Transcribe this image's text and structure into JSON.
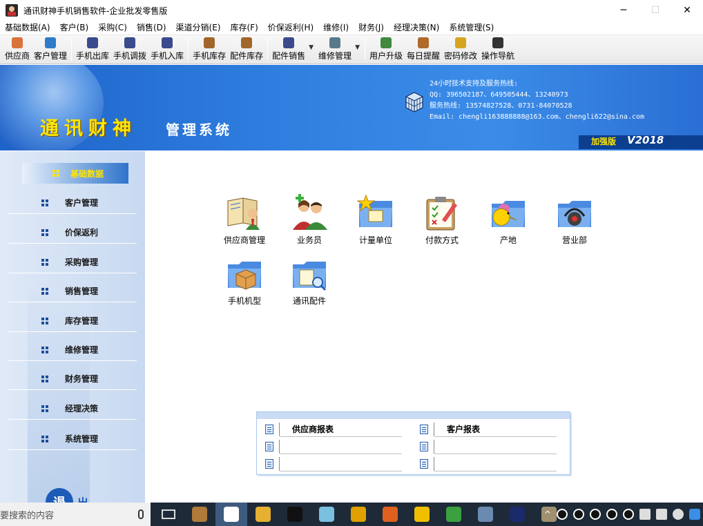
{
  "window": {
    "title": "通讯财神手机销售软件-企业批发零售版",
    "minimize": "─",
    "maximize": "☐",
    "close": "✕"
  },
  "menu": [
    "基础数据(A)",
    "客户(B)",
    "采购(C)",
    "销售(D)",
    "渠道分销(E)",
    "库存(F)",
    "价保返利(H)",
    "维修(I)",
    "财务(J)",
    "经理决策(N)",
    "系统管理(S)"
  ],
  "toolbar": {
    "groups": [
      [
        {
          "label": "供应商",
          "icon": "supplier-icon",
          "color": "#d9733b"
        },
        {
          "label": "客户管理",
          "icon": "customer-icon",
          "color": "#2e7bc9"
        }
      ],
      [
        {
          "label": "手机出库",
          "icon": "phone-out-icon",
          "color": "#3a4a8c"
        },
        {
          "label": "手机调拨",
          "icon": "phone-transfer-icon",
          "color": "#3a4a8c"
        },
        {
          "label": "手机入库",
          "icon": "phone-in-icon",
          "color": "#3a4a8c"
        }
      ],
      [
        {
          "label": "手机库存",
          "icon": "phone-stock-icon",
          "color": "#a0662b"
        },
        {
          "label": "配件库存",
          "icon": "parts-stock-icon",
          "color": "#a0662b"
        }
      ],
      [
        {
          "label": "配件销售",
          "icon": "parts-sales-icon",
          "color": "#3a4a8c",
          "dropdown": true
        },
        {
          "label": "维修管理",
          "icon": "repair-icon",
          "color": "#5a7a8c",
          "dropdown": true
        }
      ],
      [
        {
          "label": "用户升级",
          "icon": "upgrade-icon",
          "color": "#3f8a3f"
        },
        {
          "label": "每日提醒",
          "icon": "reminder-icon",
          "color": "#b06a2b"
        },
        {
          "label": "密码修改",
          "icon": "lock-icon",
          "color": "#d6a520"
        },
        {
          "label": "操作导航",
          "icon": "navigation-icon",
          "color": "#333333"
        }
      ]
    ]
  },
  "banner": {
    "brand_main": "通讯财神",
    "brand_sub": "管理系统",
    "support_lines": [
      "24小时技术支持及服务热线:",
      "  QQ: 396502187、649505444、13240973",
      "  服务热线: 13574827528、0731-84070528",
      "  Email: chengli163888888@163.com、chengli622@sina.com"
    ],
    "edition": "加强版",
    "version": "V2018",
    "accent": "#ffe600"
  },
  "sidebar": {
    "items": [
      {
        "label": "基础数据",
        "active": true
      },
      {
        "label": "客户管理"
      },
      {
        "label": "价保返利"
      },
      {
        "label": "采购管理"
      },
      {
        "label": "销售管理"
      },
      {
        "label": "库存管理"
      },
      {
        "label": "维修管理"
      },
      {
        "label": "财务管理"
      },
      {
        "label": "经理决策"
      },
      {
        "label": "系统管理"
      }
    ],
    "exit_glyph": "退",
    "exit_sub": "出"
  },
  "modules": [
    {
      "label": "供应商管理",
      "icon": "supplier-book-icon"
    },
    {
      "label": "业务员",
      "icon": "salesperson-icon"
    },
    {
      "label": "计量单位",
      "icon": "unit-folder-icon"
    },
    {
      "label": "付款方式",
      "icon": "payment-clipboard-icon"
    },
    {
      "label": "产地",
      "icon": "origin-folder-icon"
    },
    {
      "label": "营业部",
      "icon": "branch-folder-icon"
    },
    {
      "label": "手机机型",
      "icon": "phone-model-folder-icon"
    },
    {
      "label": "通讯配件",
      "icon": "parts-folder-icon"
    }
  ],
  "reports": {
    "left": [
      "供应商报表",
      "",
      ""
    ],
    "right": [
      "客户报表",
      "",
      ""
    ]
  },
  "taskbar": {
    "search_placeholder": "要搜索的内容",
    "apps": [
      "parcel-app-icon",
      "notepad-app-icon",
      "folder-app-icon",
      "qq-app-icon",
      "notes-app-icon",
      "bus-app-icon",
      "firefox-app-icon",
      "music-app-icon",
      "wechat-app-icon",
      "photos-app-icon",
      "photoshop-app-icon",
      "disc-app-icon"
    ],
    "tray_expand": "^"
  }
}
